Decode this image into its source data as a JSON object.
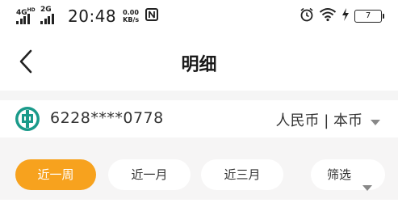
{
  "status_bar": {
    "network1": "4G",
    "network1_sup": "HD",
    "network2": "2G",
    "time": "20:48",
    "speed_value": "0.00",
    "speed_unit": "KB/s",
    "battery": "7"
  },
  "header": {
    "title": "明细"
  },
  "account": {
    "number": "6228****0778",
    "currency": "人民币 | 本币"
  },
  "filters": {
    "week": "近一周",
    "month": "近一月",
    "three_months": "近三月",
    "filter": "筛选",
    "selected": "近一周"
  },
  "colors": {
    "accent": "#f7a21e",
    "bank_logo": "#1a9a8a",
    "band": "#f5f5f5"
  }
}
